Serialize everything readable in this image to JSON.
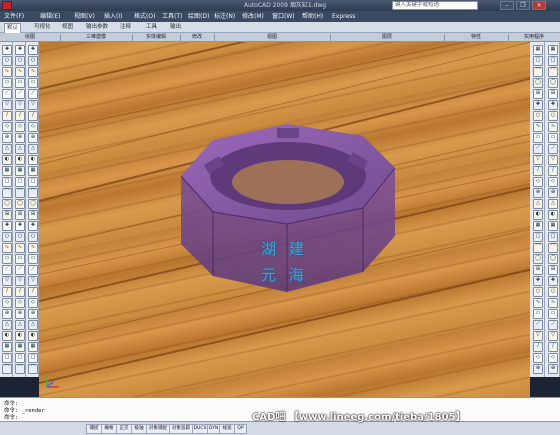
{
  "window": {
    "title": "AutoCAD 2009  烟灰缸1.dwg",
    "search_placeholder": "键入关键字或短语",
    "buttons": {
      "minimize": "–",
      "restore": "❐",
      "close": "×"
    }
  },
  "menu": [
    "文件(F)",
    "编辑(E)",
    "视图(V)",
    "插入(I)",
    "格式(O)",
    "工具(T)",
    "绘图(D)",
    "标注(N)",
    "修改(M)",
    "窗口(W)",
    "帮助(H)",
    "Express"
  ],
  "ribbon_tabs": [
    "默认",
    "可视化",
    "视图",
    "输出参数",
    "注释",
    "工具",
    "输出"
  ],
  "panels": [
    "绘图",
    "三维建模",
    "实体编辑",
    "修改",
    "视图",
    "图层",
    "特性",
    "实用程序"
  ],
  "viewport": {
    "ashtray_text_line1": "湖 建",
    "ashtray_text_line2": "元 海",
    "colors": {
      "wood": "#c98a3d",
      "tray": "#7e4f9a",
      "text": "#36a6d8"
    }
  },
  "command_line": {
    "line1": "命令:",
    "line2": "命令:  _render",
    "line3": "命令:"
  },
  "status_buttons": [
    "捕捉",
    "栅格",
    "正交",
    "极轴",
    "对象捕捉",
    "对象追踪",
    "DUCS",
    "DYN",
    "线宽",
    "QP"
  ],
  "watermark": "CAD吧  【www.lineeg.com/tieba/1805】"
}
